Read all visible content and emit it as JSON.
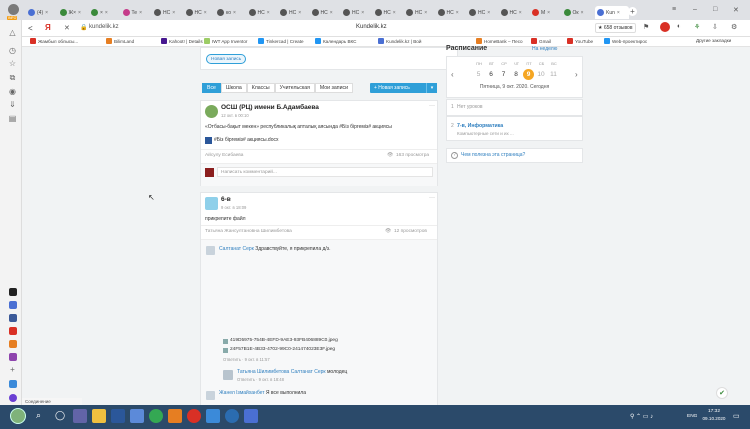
{
  "browser": {
    "page_title": "Kundelik.kz",
    "address": "kundelik.kz",
    "rating_badge": "★ 658 отзывов",
    "menu_label": "Другие закладки",
    "status_text": "Соединение"
  },
  "tabs": [
    {
      "label": "(4)",
      "color": "#4a6fd3"
    },
    {
      "label": "Ж×",
      "color": "#3b8a3b"
    },
    {
      "label": "×",
      "color": "#3b8a3b"
    },
    {
      "label": "Те",
      "color": "#c53b8a"
    },
    {
      "label": "НС",
      "color": "#555"
    },
    {
      "label": "НС",
      "color": "#555"
    },
    {
      "label": "ко",
      "color": "#555"
    },
    {
      "label": "НС",
      "color": "#555"
    },
    {
      "label": "НС",
      "color": "#555"
    },
    {
      "label": "НС",
      "color": "#555"
    },
    {
      "label": "НС",
      "color": "#555"
    },
    {
      "label": "НС",
      "color": "#555"
    },
    {
      "label": "НС",
      "color": "#555"
    },
    {
      "label": "НС",
      "color": "#555"
    },
    {
      "label": "НС",
      "color": "#555"
    },
    {
      "label": "НС",
      "color": "#555"
    },
    {
      "label": "М",
      "color": "#d93025"
    },
    {
      "label": "Ок",
      "color": "#3b8a3b"
    },
    {
      "label": "Kun",
      "color": "#fff"
    }
  ],
  "bookmarks": [
    {
      "label": "Жамбыл облысы...",
      "color": "#d93025"
    },
    {
      "label": "BilimLand",
      "color": "#e67e22"
    },
    {
      "label": "Kahoot! | Details",
      "color": "#46178f"
    },
    {
      "label": "IWT App Inventor",
      "color": "#9ccc65"
    },
    {
      "label": "Tinkercad | Create",
      "color": "#2196f3"
    },
    {
      "label": "Календарь ВКС",
      "color": "#2196f3"
    },
    {
      "label": "Kundelik.kz | Вой",
      "color": "#4a6fd3"
    },
    {
      "label": "HomeBank – Песо",
      "color": "#e67e22"
    },
    {
      "label": "Gmail",
      "color": "#d93025"
    },
    {
      "label": "YouTube",
      "color": "#d93025"
    },
    {
      "label": "Web-проектирос",
      "color": "#2196f3"
    }
  ],
  "feed": {
    "new_post_top": "Новая запись",
    "filters": [
      "Все",
      "Школа",
      "Классы",
      "Учительская",
      "Мои записи"
    ],
    "new_post_btn": "+ Новая запись",
    "post1": {
      "school": "ОСШ (РЦ) имени Б.Адамбаева",
      "time": "12 окт. в 00:10",
      "text": "«Отбасы-бақыт мекен» республикалық апталық аясында #Біз біргеміз# акциясы",
      "attachment": "#Біз біргеміз# акциясы.docx",
      "author": "Айсулу Есибаева",
      "views": "163 просмотра",
      "comment_placeholder": "Написать комментарий..."
    },
    "post2": {
      "group": "6-в",
      "time": "9 окт. в 18:09",
      "text": "прикрепите файл",
      "author": "Татьяна Жансултановна Шилимбетова",
      "views": "12 просмотров",
      "c1_author": "Салтанат Серк",
      "c1_text": "Здравствуйте, я прикрепила д/з.",
      "file1": "419D5975-754B-4EFD-9AE3-93FB406889C0.jpeg",
      "file2": "24F57B1E-4B33-4702-99C0-241474023E3F.jpeg",
      "c1_meta": "Ответить · 9 окт. в 11:57",
      "c2_author": "Татьяна Шилимбетова",
      "c2_target": "Салтанат Серк",
      "c2_text": "молодец",
      "c2_meta": "Ответить · 9 окт. в 18:48",
      "c3_author": "Жанел Ізмайханбет",
      "c3_text": "Я все выполнила"
    }
  },
  "schedule": {
    "title": "Расписание",
    "week_link": "На неделю",
    "weekdays": [
      "ПН",
      "ВТ",
      "СР",
      "ЧТ",
      "ПТ",
      "СБ",
      "ВС"
    ],
    "days": [
      "5",
      "6",
      "7",
      "8",
      "9",
      "10",
      "11"
    ],
    "selected_index": 4,
    "date_caption": "Пятница, 9 окт. 2020. Сегодня",
    "lesson1_num": "1",
    "lesson1_text": "Нет уроков",
    "lesson2_num": "2",
    "lesson2_title": "7-в, Информатика",
    "lesson2_sub": "Компьютерные сети и их ...",
    "help_link": "Чем полезна эта страница?"
  },
  "taskbar": {
    "lang": "ENG",
    "time": "17:32",
    "date": "09.10.2020"
  }
}
